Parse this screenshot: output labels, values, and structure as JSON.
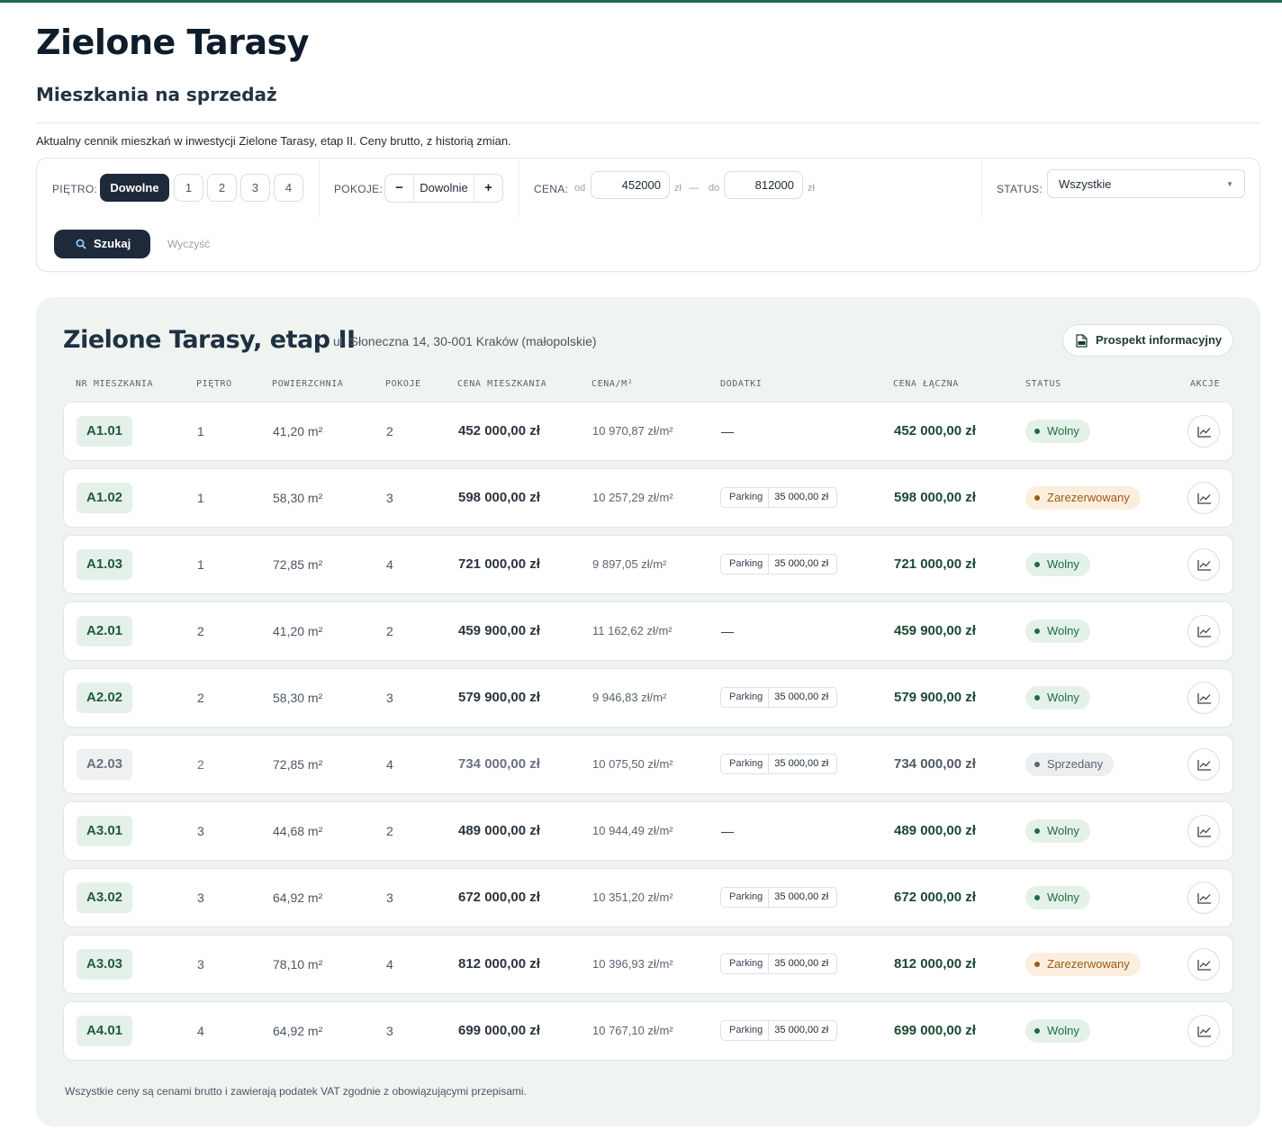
{
  "header": {
    "title": "Zielone Tarasy",
    "subtitle": "Mieszkania na sprzedaż",
    "intro": "Aktualny cennik mieszkań w inwestycji Zielone Tarasy, etap II. Ceny brutto, z historią zmian."
  },
  "filters": {
    "floor_label": "PIĘTRO:",
    "floor_options": [
      "Dowolne",
      "1",
      "2",
      "3",
      "4"
    ],
    "floor_selected": "Dowolne",
    "rooms_label": "POKOJE:",
    "rooms_minus": "−",
    "rooms_value": "Dowolnie",
    "rooms_plus": "+",
    "price_label": "CENA:",
    "price_from_label": "od",
    "price_from": "452000",
    "price_to_label": "do",
    "price_to": "812000",
    "currency": "zł",
    "range_dash": "—",
    "status_label": "STATUS:",
    "status_value": "Wszystkie",
    "search_label": "Szukaj",
    "clear_label": "Wyczyść"
  },
  "listing": {
    "title": "Zielone Tarasy, etap II",
    "address": "ul. Słoneczna 14, 30-001 Kraków (małopolskie)",
    "pdf_button": "Prospekt informacyjny",
    "columns": [
      "NR MIESZKANIA",
      "PIĘTRO",
      "POWIERZCHNIA",
      "POKOJE",
      "CENA MIESZKANIA",
      "CENA/M²",
      "DODATKI",
      "CENA ŁĄCZNA",
      "STATUS",
      "AKCJE"
    ],
    "rows": [
      {
        "id": "A1.01",
        "floor": "1",
        "area": "41,20 m²",
        "rooms": "2",
        "price": "452 000,00 zł",
        "per_sqm": "10 970,87 zł/m²",
        "addon": null,
        "total": "452 000,00 zł",
        "status": "Wolny",
        "status_type": "free"
      },
      {
        "id": "A1.02",
        "floor": "1",
        "area": "58,30 m²",
        "rooms": "3",
        "price": "598 000,00 zł",
        "per_sqm": "10 257,29 zł/m²",
        "addon": {
          "name": "Parking",
          "price": "35 000,00 zł"
        },
        "total": "598 000,00 zł",
        "status": "Zarezerwowany",
        "status_type": "reserved"
      },
      {
        "id": "A1.03",
        "floor": "1",
        "area": "72,85 m²",
        "rooms": "4",
        "price": "721 000,00 zł",
        "per_sqm": "9 897,05 zł/m²",
        "addon": {
          "name": "Parking",
          "price": "35 000,00 zł"
        },
        "total": "721 000,00 zł",
        "status": "Wolny",
        "status_type": "free"
      },
      {
        "id": "A2.01",
        "floor": "2",
        "area": "41,20 m²",
        "rooms": "2",
        "price": "459 900,00 zł",
        "per_sqm": "11 162,62 zł/m²",
        "addon": null,
        "total": "459 900,00 zł",
        "status": "Wolny",
        "status_type": "free"
      },
      {
        "id": "A2.02",
        "floor": "2",
        "area": "58,30 m²",
        "rooms": "3",
        "price": "579 900,00 zł",
        "per_sqm": "9 946,83 zł/m²",
        "addon": {
          "name": "Parking",
          "price": "35 000,00 zł"
        },
        "total": "579 900,00 zł",
        "status": "Wolny",
        "status_type": "free"
      },
      {
        "id": "A2.03",
        "floor": "2",
        "area": "72,85 m²",
        "rooms": "4",
        "price": "734 000,00 zł",
        "per_sqm": "10 075,50 zł/m²",
        "addon": {
          "name": "Parking",
          "price": "35 000,00 zł"
        },
        "total": "734 000,00 zł",
        "status": "Sprzedany",
        "status_type": "sold"
      },
      {
        "id": "A3.01",
        "floor": "3",
        "area": "44,68 m²",
        "rooms": "2",
        "price": "489 000,00 zł",
        "per_sqm": "10 944,49 zł/m²",
        "addon": null,
        "total": "489 000,00 zł",
        "status": "Wolny",
        "status_type": "free"
      },
      {
        "id": "A3.02",
        "floor": "3",
        "area": "64,92 m²",
        "rooms": "3",
        "price": "672 000,00 zł",
        "per_sqm": "10 351,20 zł/m²",
        "addon": {
          "name": "Parking",
          "price": "35 000,00 zł"
        },
        "total": "672 000,00 zł",
        "status": "Wolny",
        "status_type": "free"
      },
      {
        "id": "A3.03",
        "floor": "3",
        "area": "78,10 m²",
        "rooms": "4",
        "price": "812 000,00 zł",
        "per_sqm": "10 396,93 zł/m²",
        "addon": {
          "name": "Parking",
          "price": "35 000,00 zł"
        },
        "total": "812 000,00 zł",
        "status": "Zarezerwowany",
        "status_type": "reserved"
      },
      {
        "id": "A4.01",
        "floor": "4",
        "area": "64,92 m²",
        "rooms": "3",
        "price": "699 000,00 zł",
        "per_sqm": "10 767,10 zł/m²",
        "addon": {
          "name": "Parking",
          "price": "35 000,00 zł"
        },
        "total": "699 000,00 zł",
        "status": "Wolny",
        "status_type": "free"
      }
    ],
    "no_addon": "—",
    "action_icon": "chart-line-icon",
    "footnote": "Wszystkie ceny są cenami brutto i zawierają podatek VAT zgodnie z obowiązującymi przepisami."
  },
  "colors": {
    "top_border": "#1f6b4f",
    "dark": "#1e2a3a",
    "card_bg": "#f0f4f1",
    "free": "#1f6b45",
    "reserved": "#9a5a14",
    "sold": "#5b6470"
  }
}
